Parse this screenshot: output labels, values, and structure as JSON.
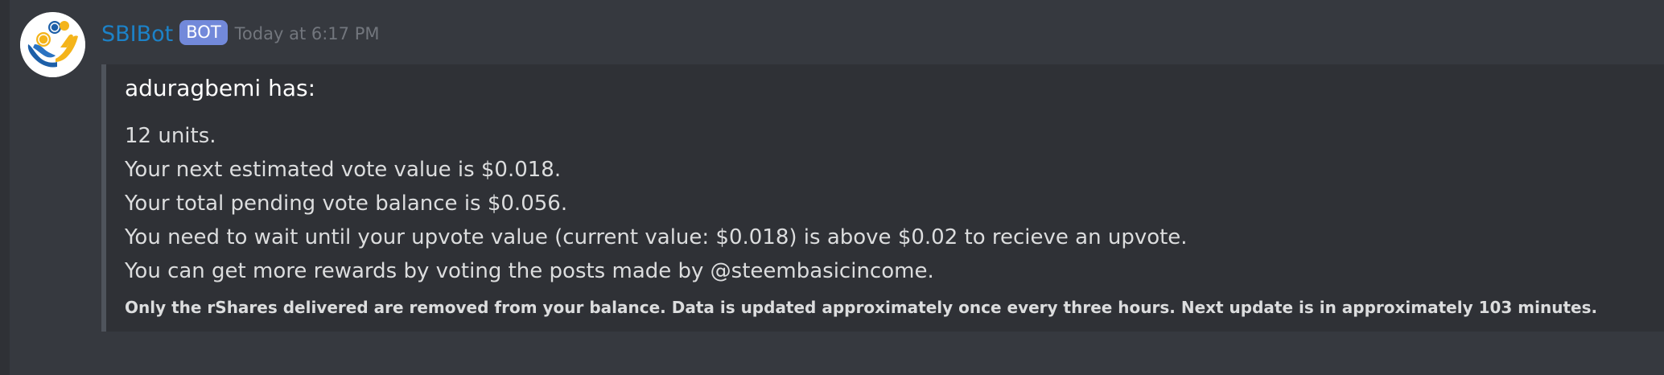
{
  "message": {
    "author": "SBIBot",
    "tag": "BOT",
    "timestamp": "Today at 6:17 PM",
    "colors": {
      "author": "#1c82c8",
      "tag_bg": "#7289da",
      "background": "#36393f",
      "embed_bg": "#2f3136",
      "embed_border": "#4f545c"
    }
  },
  "embed": {
    "title": "aduragbemi has:",
    "lines": [
      "12 units.",
      "Your next estimated vote value is $0.018.",
      "Your total pending vote balance is $0.056.",
      "You need to wait until your upvote value (current value: $0.018) is above $0.02 to recieve an upvote.",
      "You can get more rewards by voting the posts made by @steembasicincome."
    ],
    "footer": "Only the rShares delivered are removed from your balance. Data is updated approximately once every three hours. Next update is in approximately 103 minutes."
  },
  "icons": {
    "avatar": "hands-coins-logo-icon"
  }
}
